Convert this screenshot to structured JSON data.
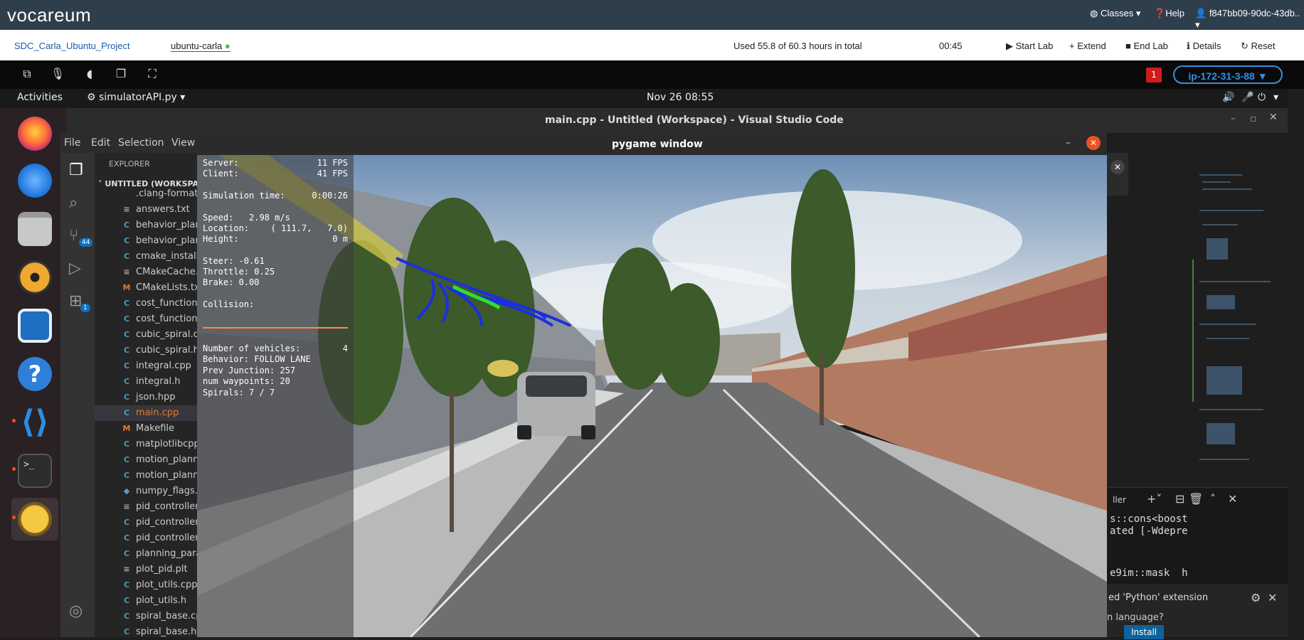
{
  "vocareum": {
    "logo": "vocareum",
    "menu": {
      "classes": "Classes ▾",
      "help": "Help",
      "user": "f847bb09-90dc-43db.. ▾"
    },
    "project": "SDC_Carla_Ubuntu_Project",
    "env": "ubuntu-carla",
    "usage": "Used 55.8 of 60.3 hours in total",
    "timer": "00:45",
    "actions": {
      "start": "Start Lab",
      "extend": "Extend",
      "end": "End Lab",
      "details": "Details",
      "reset": "Reset"
    }
  },
  "dcv": {
    "notification_count": "1",
    "host": "ip-172-31-3-88"
  },
  "gnome": {
    "activities": "Activities",
    "app": "simulatorAPI.py ▾",
    "clock": "Nov 26  08:55"
  },
  "vscode": {
    "title": "main.cpp - Untitled (Workspace) - Visual Studio Code",
    "menu": [
      "File",
      "Edit",
      "Selection",
      "View"
    ],
    "explorer_title": "EXPLORER",
    "workspace": "UNTITLED (WORKSPACE)",
    "source_control_badge": "44",
    "extensions_badge": "1",
    "files": [
      {
        "name": ".clang-format",
        "icon": ""
      },
      {
        "name": "answers.txt",
        "icon": "≡"
      },
      {
        "name": "behavior_planner.cpp",
        "icon": "C"
      },
      {
        "name": "behavior_planner.h",
        "icon": "C"
      },
      {
        "name": "cmake_install.cmake",
        "icon": "C"
      },
      {
        "name": "CMakeCache.txt",
        "icon": "≡"
      },
      {
        "name": "CMakeLists.txt",
        "icon": "M"
      },
      {
        "name": "cost_functions.cpp",
        "icon": "C"
      },
      {
        "name": "cost_functions.h",
        "icon": "C"
      },
      {
        "name": "cubic_spiral.cpp",
        "icon": "C"
      },
      {
        "name": "cubic_spiral.h",
        "icon": "C"
      },
      {
        "name": "integral.cpp",
        "icon": "C"
      },
      {
        "name": "integral.h",
        "icon": "C"
      },
      {
        "name": "json.hpp",
        "icon": "C"
      },
      {
        "name": "main.cpp",
        "icon": "C"
      },
      {
        "name": "Makefile",
        "icon": "M"
      },
      {
        "name": "matplotlibcpp.h",
        "icon": "C"
      },
      {
        "name": "motion_planner.cpp",
        "icon": "C"
      },
      {
        "name": "motion_planner.h",
        "icon": "C"
      },
      {
        "name": "numpy_flags.py",
        "icon": "◆"
      },
      {
        "name": "pid_controller",
        "icon": "≡"
      },
      {
        "name": "pid_controller.cpp",
        "icon": "C"
      },
      {
        "name": "pid_controller.h",
        "icon": "C"
      },
      {
        "name": "planning_params.h",
        "icon": "C"
      },
      {
        "name": "plot_pid.plt",
        "icon": "≡"
      },
      {
        "name": "plot_utils.cpp",
        "icon": "C"
      },
      {
        "name": "plot_utils.h",
        "icon": "C"
      },
      {
        "name": "spiral_base.cpp",
        "icon": "C"
      },
      {
        "name": "spiral_base.h",
        "icon": "C"
      }
    ],
    "terminal_lines": [
      "s::cons<boost",
      "ated [-Wdepre",
      "e9im::mask  h"
    ],
    "terminal_tab": "ller",
    "notification": "ed 'Python' extension",
    "notification_sub": "n language?",
    "install_label": "Install"
  },
  "pygame": {
    "title": "pygame window",
    "hud": {
      "server_label": "Server:",
      "server_value": "11 FPS",
      "client_label": "Client:",
      "client_value": "41 FPS",
      "sim_label": "Simulation time:",
      "sim_value": "0:00:26",
      "speed": "Speed:   2.98 m/s",
      "location_label": "Location:",
      "location_value": "( 111.7,   7.0)",
      "height_label": "Height:",
      "height_value": "0 m",
      "steer": "Steer: -0.61",
      "throttle": "Throttle: 0.25",
      "brake": "Brake: 0.00",
      "collision": "Collision:",
      "vehicles_label": "Number of vehicles:",
      "vehicles_value": "4",
      "behavior": "Behavior: FOLLOW LANE",
      "junction": "Prev Junction: 257",
      "waypoints": "num waypoints: 20",
      "spirals": "Spirals: 7 / 7"
    }
  }
}
